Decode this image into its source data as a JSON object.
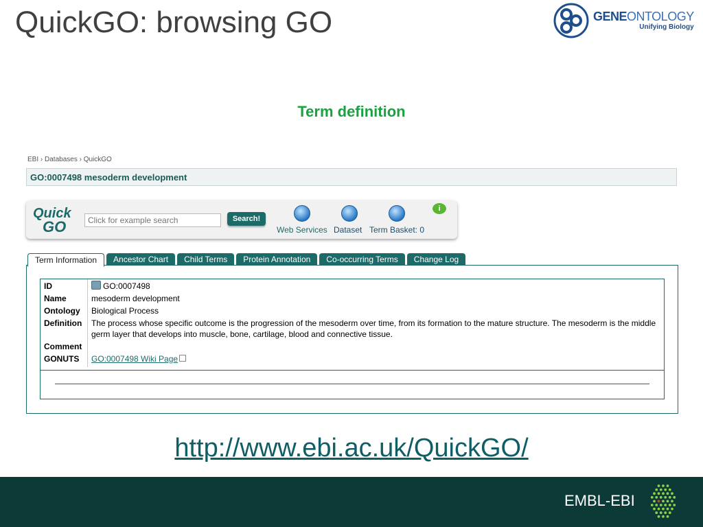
{
  "slide": {
    "title": "QuickGO: browsing GO",
    "subtitle": "Term definition",
    "url": "http://www.ebi.ac.uk/QuickGO/"
  },
  "logo": {
    "name_part1": "GENE",
    "name_part2": "ONTOLOGY",
    "tagline": "Unifying Biology"
  },
  "breadcrumb": "EBI › Databases › QuickGO",
  "term_header": "GO:0007498 mesoderm development",
  "toolbar": {
    "logo_quick": "Quick",
    "logo_go": "GO",
    "search_placeholder": "Click for example search",
    "search_button": "Search!",
    "web_services": "Web Services",
    "dataset": "Dataset",
    "term_basket": "Term Basket: 0",
    "info": "i"
  },
  "tabs": [
    {
      "label": "Term Information",
      "active": true
    },
    {
      "label": "Ancestor Chart",
      "active": false
    },
    {
      "label": "Child Terms",
      "active": false
    },
    {
      "label": "Protein Annotation",
      "active": false
    },
    {
      "label": "Co-occurring Terms",
      "active": false
    },
    {
      "label": "Change Log",
      "active": false
    }
  ],
  "term_info": {
    "id_label": "ID",
    "id_value": "GO:0007498",
    "name_label": "Name",
    "name_value": "mesoderm development",
    "ontology_label": "Ontology",
    "ontology_value": "Biological Process",
    "definition_label": "Definition",
    "definition_value": "The process whose specific outcome is the progression of the mesoderm over time, from its formation to the mature structure. The mesoderm is the middle germ layer that develops into muscle, bone, cartilage, blood and connective tissue.",
    "comment_label": "Comment",
    "comment_value": "",
    "gonuts_label": "GONUTS",
    "gonuts_value": "GO:0007498 Wiki Page"
  },
  "footer": {
    "org": "EMBL-EBI"
  },
  "colors": {
    "accent_green": "#1aa141",
    "teal": "#1d6b68",
    "footer_bg": "#0b3a37"
  }
}
